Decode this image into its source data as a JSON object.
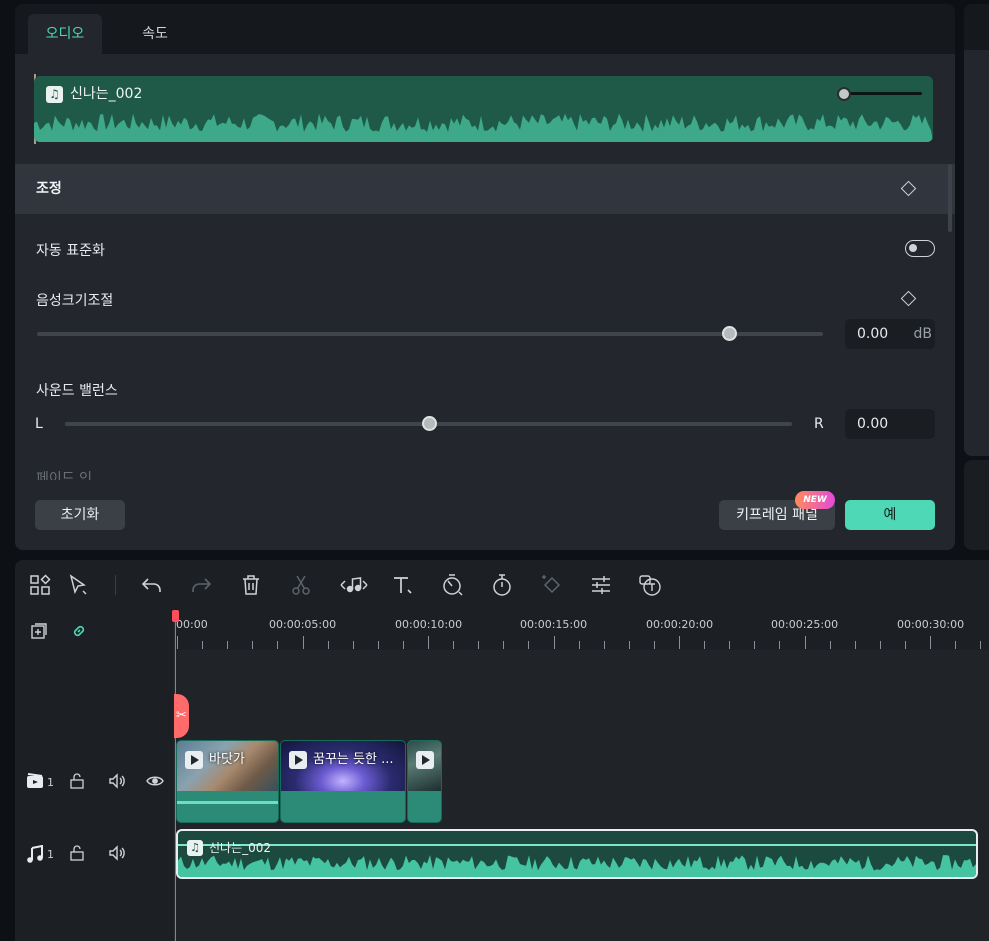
{
  "tabs": [
    {
      "label": "오디오",
      "active": true
    },
    {
      "label": "속도",
      "active": false
    }
  ],
  "clip": {
    "name": "신나는_002",
    "icon": "music-note-icon"
  },
  "section": {
    "title": "조정"
  },
  "auto_normalize": {
    "label": "자동 표준화",
    "enabled": false
  },
  "volume": {
    "label": "음성크기조절",
    "value": "0.00",
    "unit": "dB",
    "level_percent": 88
  },
  "balance": {
    "label": "사운드 밸런스",
    "left": "L",
    "right": "R",
    "value": "0.00",
    "level_percent": 50
  },
  "fade_in": {
    "label": "페이드 인"
  },
  "footer": {
    "reset": "초기화",
    "keyframe_panel": "키프레임 패널",
    "new_badge": "NEW",
    "ok": "예"
  },
  "colors": {
    "accent": "#4fd8b6",
    "playhead": "#ff4d5e",
    "audio_clip": "#1f5a48",
    "new_badge": "#e34bd8"
  },
  "toolbar": [
    "layout-icon",
    "select-arrow-icon",
    "undo-icon",
    "redo-icon",
    "delete-icon",
    "scissors-icon",
    "audio-edit-icon",
    "text-icon",
    "speed-icon",
    "timer-icon",
    "keyframe-icon",
    "adjust-sliders-icon",
    "speech-to-text-icon"
  ],
  "ruler": {
    "labels": [
      "00:00",
      "00:00:05:00",
      "00:00:10:00",
      "00:00:15:00",
      "00:00:20:00",
      "00:00:25:00",
      "00:00:30:00"
    ]
  },
  "tracks": {
    "video": {
      "number": "1"
    },
    "audio": {
      "number": "1"
    }
  },
  "video_clips": [
    {
      "name": "바닷가"
    },
    {
      "name": "꿈꾸는 듯한 ..."
    },
    {
      "name": ""
    }
  ],
  "audio_clip": {
    "name": "신나는_002"
  }
}
